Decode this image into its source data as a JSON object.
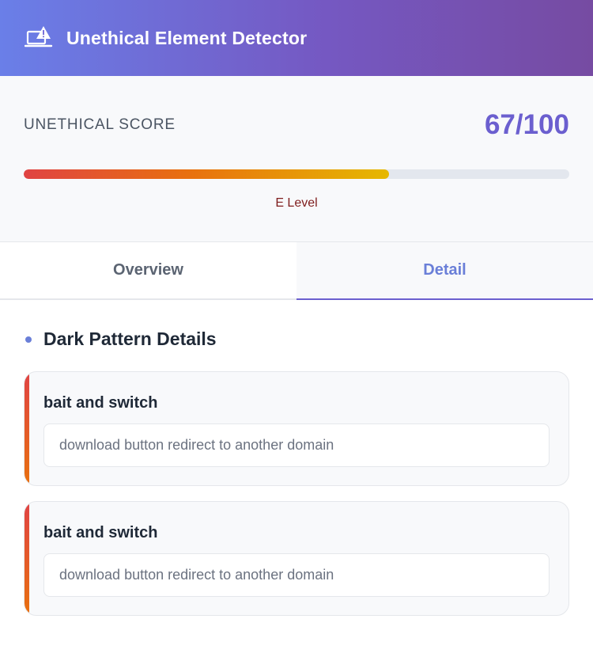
{
  "header": {
    "title": "Unethical Element Detector",
    "icon": "laptop-warning-icon"
  },
  "score": {
    "label": "UNETHICAL SCORE",
    "value": "67/100",
    "progress_percent": 67,
    "level": "E Level",
    "colors": {
      "value": "#6b5fcf",
      "level": "#7f1d1d",
      "bar_start": "#e04343",
      "bar_mid": "#e8700f",
      "bar_end": "#e6b800"
    }
  },
  "tabs": [
    {
      "label": "Overview",
      "active": false
    },
    {
      "label": "Detail",
      "active": true
    }
  ],
  "details": {
    "heading": "Dark Pattern Details",
    "items": [
      {
        "title": "bait and switch",
        "description": "download button redirect to another domain"
      },
      {
        "title": "bait and switch",
        "description": "download button redirect to another domain"
      }
    ]
  }
}
